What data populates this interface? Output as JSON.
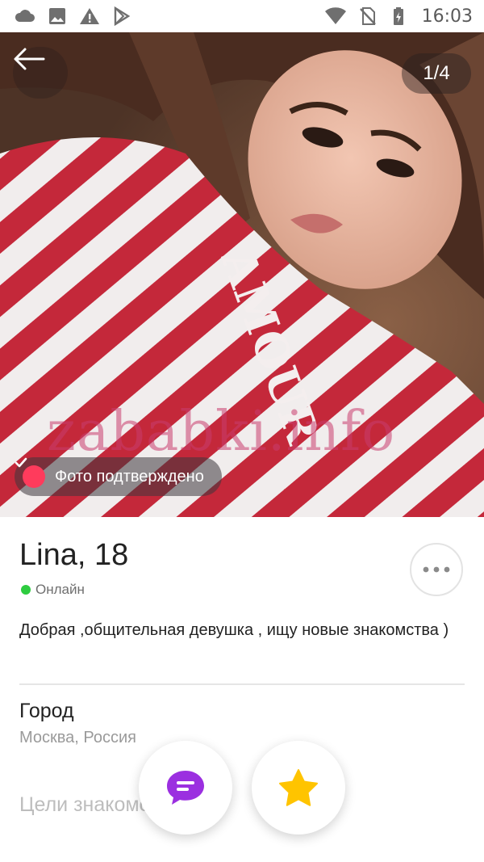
{
  "status_bar": {
    "time": "16:03",
    "left_icons": [
      "cloud-icon",
      "image-icon",
      "warning-icon",
      "play-store-icon"
    ],
    "right_icons": [
      "wifi-icon",
      "no-sim-icon",
      "battery-icon"
    ]
  },
  "photo": {
    "counter": "1/4",
    "watermark": "zababki.info",
    "verified_label": "Фото подтверждено",
    "shirt_text": "AMOUR"
  },
  "profile": {
    "name_age": "Lina, 18",
    "online_status": "Онлайн",
    "bio": "Добрая ,общительная девушка , ищу новые знакомства )",
    "city_label": "Город",
    "city_value": "Москва, Россия",
    "goals_label": "Цели знакомства"
  },
  "colors": {
    "accent": "#ff3b5c",
    "online": "#2ecc40",
    "chat_icon": "#9b2fe0",
    "star_icon": "#ffc400"
  }
}
